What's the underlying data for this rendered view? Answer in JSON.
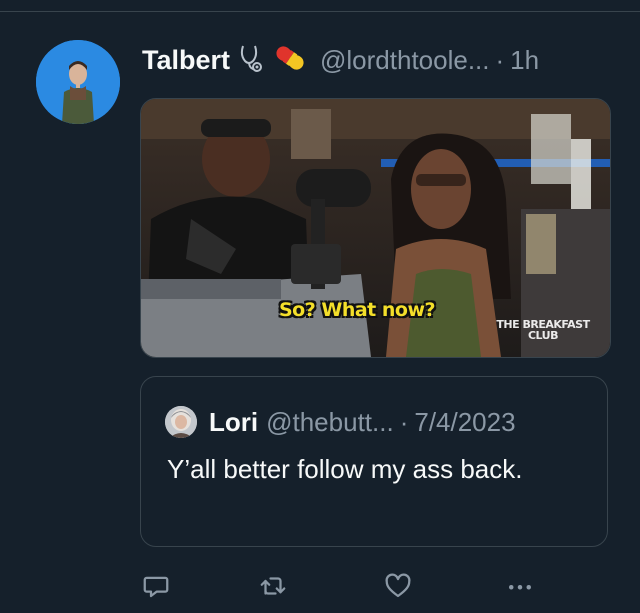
{
  "tweet": {
    "author_name": "Talbert",
    "author_emoji_1": "stethoscope",
    "author_emoji_2": "pill",
    "handle": "@lordthtoole...",
    "separator": "·",
    "time": "1h"
  },
  "media": {
    "kind": "animated-gif",
    "caption": "So? What now?",
    "watermark_top": "THE BREAKFAST",
    "watermark_bottom": "CLUB"
  },
  "quoted_tweet": {
    "author_name": "Lori",
    "handle": "@thebutt...",
    "separator": "·",
    "date": "7/4/2023",
    "text": "Y’all better follow my ass back."
  },
  "actions": [
    {
      "icon": "reply-icon"
    },
    {
      "icon": "retweet-icon"
    },
    {
      "icon": "like-icon"
    },
    {
      "icon": "more-icon"
    }
  ],
  "colors": {
    "background": "#15202b",
    "border": "#38444d",
    "secondary_text": "#8b98a5",
    "accent": "#1d9bf0"
  }
}
